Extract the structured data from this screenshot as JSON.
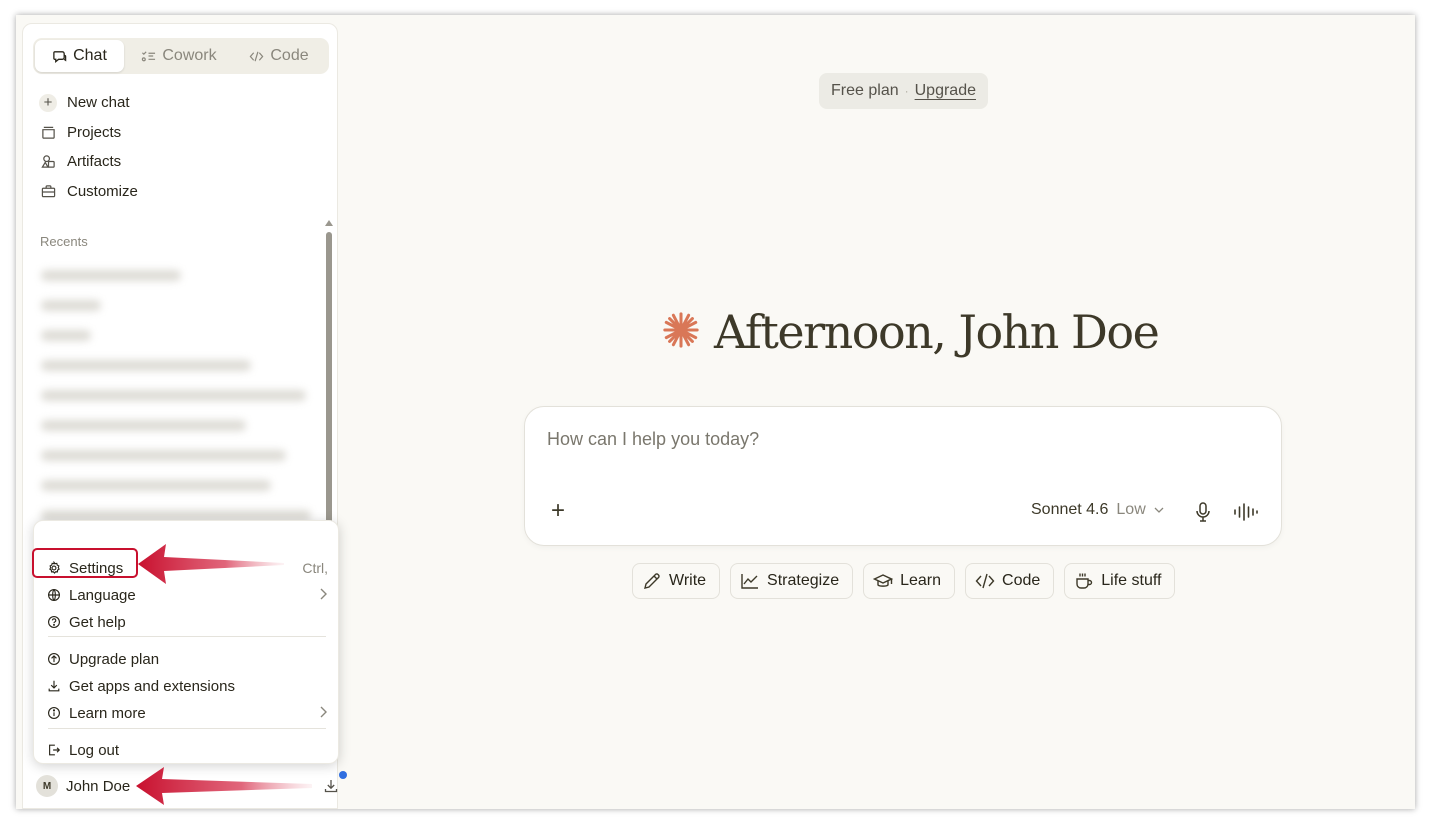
{
  "sidebar": {
    "mode_tabs": [
      {
        "label": "Chat",
        "icon": "chat-bubble-icon",
        "active": true
      },
      {
        "label": "Cowork",
        "icon": "checklist-icon",
        "active": false
      },
      {
        "label": "Code",
        "icon": "code-icon",
        "active": false
      }
    ],
    "nav_items": [
      {
        "label": "New chat",
        "icon": "plus-icon"
      },
      {
        "label": "Projects",
        "icon": "folder-icon"
      },
      {
        "label": "Artifacts",
        "icon": "shapes-icon"
      },
      {
        "label": "Customize",
        "icon": "briefcase-icon"
      }
    ],
    "recents_label": "Recents"
  },
  "menu": {
    "items": [
      {
        "label": "Settings",
        "icon": "gear-icon",
        "shortcut": "Ctrl,"
      },
      {
        "label": "Language",
        "icon": "globe-icon",
        "submenu": true
      },
      {
        "label": "Get help",
        "icon": "help-circle-icon"
      },
      {
        "label": "Upgrade plan",
        "icon": "arrow-up-circle-icon"
      },
      {
        "label": "Get apps and extensions",
        "icon": "download-icon"
      },
      {
        "label": "Learn more",
        "icon": "info-circle-icon",
        "submenu": true
      },
      {
        "label": "Log out",
        "icon": "logout-icon"
      }
    ]
  },
  "user": {
    "avatar_initial": "M",
    "name": "John Doe"
  },
  "main": {
    "plan": {
      "label": "Free plan",
      "separator": "·",
      "upgrade": "Upgrade"
    },
    "greeting": "Afternoon, John Doe",
    "composer": {
      "placeholder": "How can I help you today?",
      "model": "Sonnet 4.6",
      "effort": "Low"
    },
    "chips": [
      {
        "label": "Write",
        "icon": "pencil-icon"
      },
      {
        "label": "Strategize",
        "icon": "line-chart-icon"
      },
      {
        "label": "Learn",
        "icon": "graduation-cap-icon"
      },
      {
        "label": "Code",
        "icon": "code-icon"
      },
      {
        "label": "Life stuff",
        "icon": "coffee-cup-icon"
      }
    ]
  },
  "colors": {
    "accent": "#d97757",
    "background": "#faf9f5",
    "highlight": "#c8102e",
    "notify": "#2f6ee0"
  }
}
